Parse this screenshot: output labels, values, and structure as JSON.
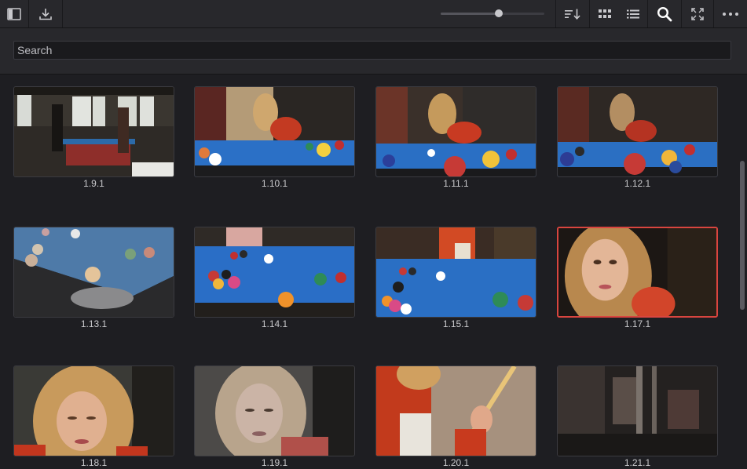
{
  "toolbar": {
    "buttons": [
      {
        "name": "sidebar-toggle-icon"
      },
      {
        "name": "import-icon"
      },
      {
        "name": "sort-icon"
      },
      {
        "name": "grid-view-icon"
      },
      {
        "name": "list-view-icon"
      },
      {
        "name": "search-icon"
      },
      {
        "name": "fullscreen-icon"
      },
      {
        "name": "more-options-icon"
      }
    ],
    "zoom_slider": {
      "value": 0.56
    }
  },
  "search": {
    "placeholder": "Search",
    "value": ""
  },
  "clips": [
    {
      "label": "1.9.1",
      "selected": false
    },
    {
      "label": "1.10.1",
      "selected": false
    },
    {
      "label": "1.11.1",
      "selected": false
    },
    {
      "label": "1.12.1",
      "selected": false
    },
    {
      "label": "1.13.1",
      "selected": false
    },
    {
      "label": "1.14.1",
      "selected": false
    },
    {
      "label": "1.15.1",
      "selected": false
    },
    {
      "label": "1.17.1",
      "selected": true
    },
    {
      "label": "1.18.1",
      "selected": false
    },
    {
      "label": "1.19.1",
      "selected": false
    },
    {
      "label": "1.20.1",
      "selected": false
    },
    {
      "label": "1.21.1",
      "selected": false
    }
  ],
  "colors": {
    "accent_selected": "#d9453f",
    "table_blue": "#2a6fc4"
  }
}
